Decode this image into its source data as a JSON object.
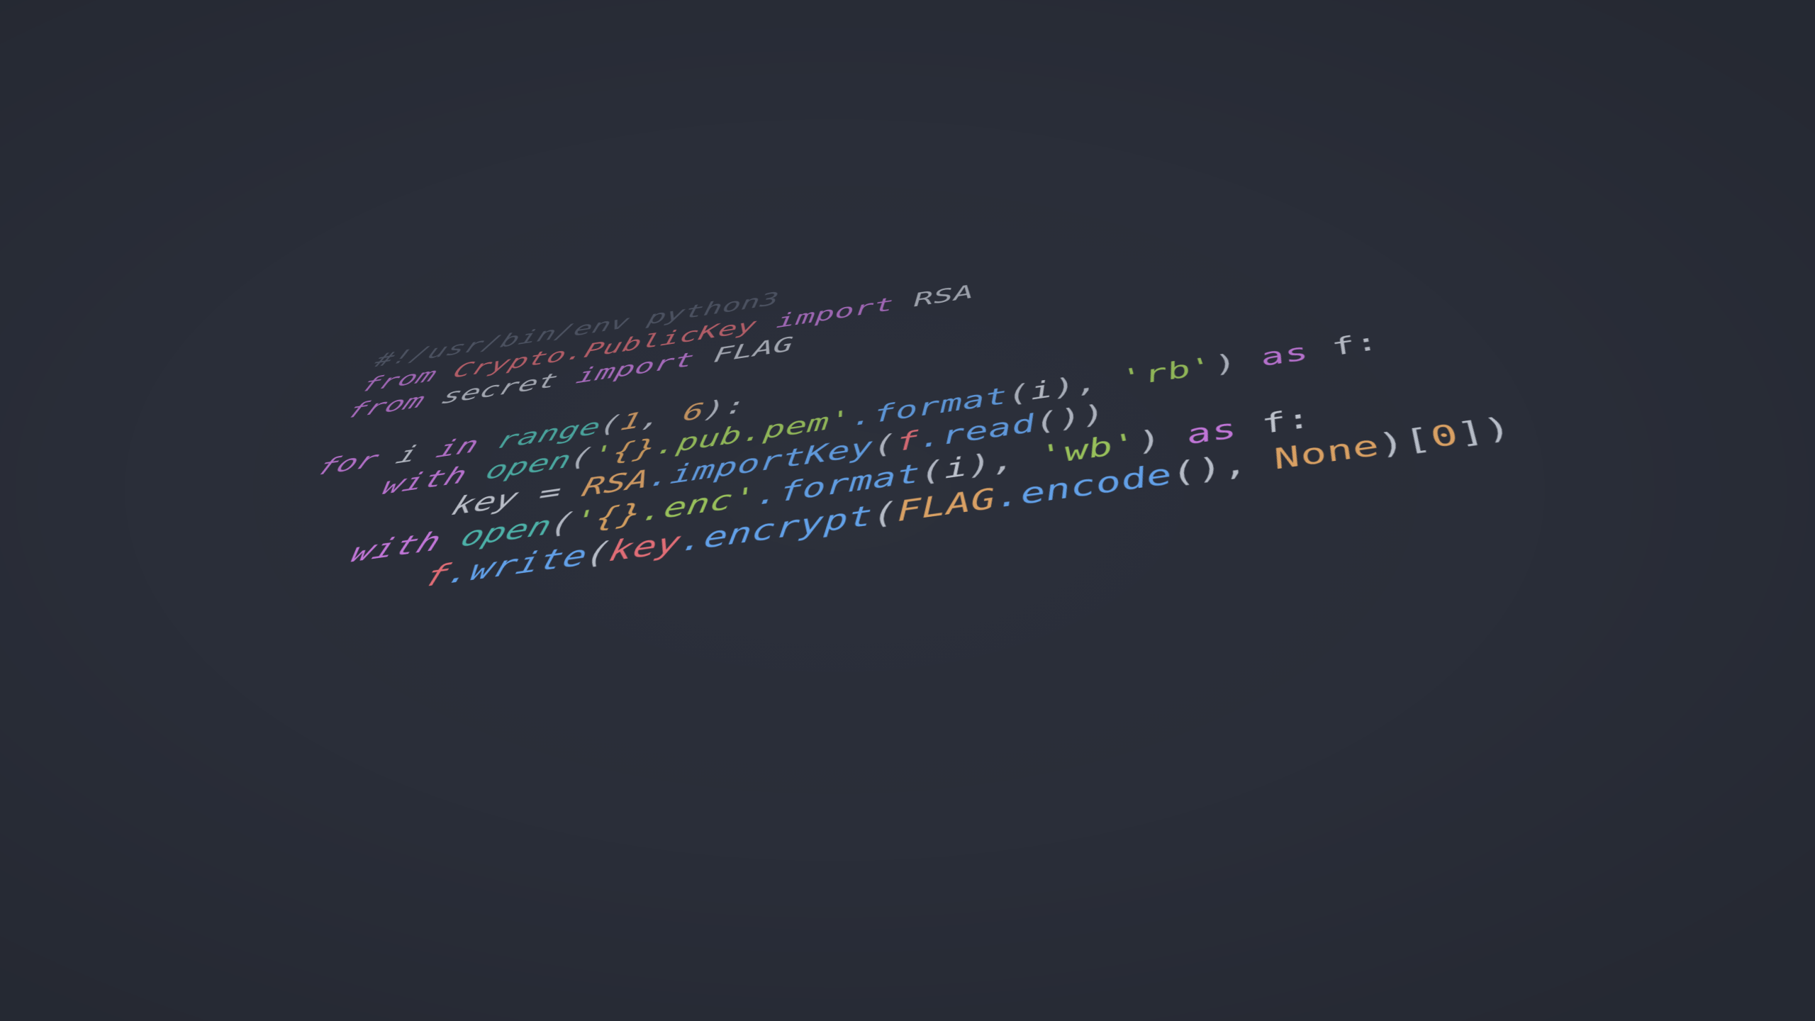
{
  "wallpaper": {
    "background_color": "#2a2e39",
    "language": "python",
    "title": "rsa-encrypt-flag-script"
  },
  "palette": {
    "background": "#2a2e39",
    "comment": "#596070",
    "keyword": "#c678dd",
    "module": "#e06c75",
    "builtin_function": "#4db6ac",
    "string": "#9cc65a",
    "format_placeholder": "#d7a05e",
    "method": "#61a0e8",
    "number": "#d9a063",
    "constant": "#d9a063",
    "variable": "#e06c75",
    "plain_text": "#c3c8d2"
  },
  "code": {
    "lines": [
      {
        "id": "line-shebang",
        "text": "#!/usr/bin/env python3",
        "tokens": [
          {
            "t": "#!/usr/bin/env python3",
            "c": "tok-comment"
          }
        ]
      },
      {
        "id": "line-import-rsa",
        "text": "from Crypto.PublicKey import RSA",
        "tokens": [
          {
            "t": "from",
            "c": "tok-keyword"
          },
          {
            "t": " ",
            "c": "tok-plain"
          },
          {
            "t": "Crypto.PublicKey",
            "c": "tok-module"
          },
          {
            "t": " ",
            "c": "tok-plain"
          },
          {
            "t": "import",
            "c": "tok-keyword"
          },
          {
            "t": " ",
            "c": "tok-plain"
          },
          {
            "t": "RSA",
            "c": "tok-caps"
          }
        ]
      },
      {
        "id": "line-import-flag",
        "text": "from secret import FLAG",
        "tokens": [
          {
            "t": "from",
            "c": "tok-keyword"
          },
          {
            "t": " ",
            "c": "tok-plain"
          },
          {
            "t": "secret",
            "c": "tok-plain"
          },
          {
            "t": " ",
            "c": "tok-plain"
          },
          {
            "t": "import",
            "c": "tok-keyword"
          },
          {
            "t": " ",
            "c": "tok-plain"
          },
          {
            "t": "FLAG",
            "c": "tok-caps"
          }
        ]
      },
      {
        "id": "line-blank-1",
        "text": "",
        "tokens": []
      },
      {
        "id": "line-for-loop",
        "text": "for i in range(1, 6):",
        "tokens": [
          {
            "t": "for",
            "c": "tok-keyword"
          },
          {
            "t": " ",
            "c": "tok-plain"
          },
          {
            "t": "i",
            "c": "tok-plain"
          },
          {
            "t": " ",
            "c": "tok-plain"
          },
          {
            "t": "in",
            "c": "tok-keyword"
          },
          {
            "t": " ",
            "c": "tok-plain"
          },
          {
            "t": "range",
            "c": "tok-builtin"
          },
          {
            "t": "(",
            "c": "tok-punct"
          },
          {
            "t": "1",
            "c": "tok-number"
          },
          {
            "t": ", ",
            "c": "tok-punct"
          },
          {
            "t": "6",
            "c": "tok-number"
          },
          {
            "t": "):",
            "c": "tok-punct"
          }
        ]
      },
      {
        "id": "line-open-pub-pem",
        "text": "    with open('{}.pub.pem'.format(i), 'rb') as f:",
        "tokens": [
          {
            "t": "    ",
            "c": "tok-plain"
          },
          {
            "t": "with",
            "c": "tok-keyword"
          },
          {
            "t": " ",
            "c": "tok-plain"
          },
          {
            "t": "open",
            "c": "tok-builtin"
          },
          {
            "t": "(",
            "c": "tok-punct"
          },
          {
            "t": "'",
            "c": "tok-string"
          },
          {
            "t": "{}",
            "c": "tok-fmt"
          },
          {
            "t": ".pub.pem'",
            "c": "tok-string"
          },
          {
            "t": ".format",
            "c": "tok-method"
          },
          {
            "t": "(",
            "c": "tok-punct"
          },
          {
            "t": "i",
            "c": "tok-plain"
          },
          {
            "t": "), ",
            "c": "tok-punct"
          },
          {
            "t": "'rb'",
            "c": "tok-string"
          },
          {
            "t": ") ",
            "c": "tok-punct"
          },
          {
            "t": "as",
            "c": "tok-keyword"
          },
          {
            "t": " ",
            "c": "tok-plain"
          },
          {
            "t": "f:",
            "c": "tok-plain"
          }
        ]
      },
      {
        "id": "line-import-key",
        "text": "        key = RSA.importKey(f.read())",
        "tokens": [
          {
            "t": "        ",
            "c": "tok-plain"
          },
          {
            "t": "key",
            "c": "tok-plain"
          },
          {
            "t": " = ",
            "c": "tok-plain"
          },
          {
            "t": "RSA",
            "c": "tok-class"
          },
          {
            "t": ".importKey",
            "c": "tok-method"
          },
          {
            "t": "(",
            "c": "tok-punct"
          },
          {
            "t": "f",
            "c": "tok-var"
          },
          {
            "t": ".read",
            "c": "tok-method"
          },
          {
            "t": "())",
            "c": "tok-punct"
          }
        ]
      },
      {
        "id": "line-open-enc",
        "text": "    with open('{}.enc'.format(i), 'wb') as f:",
        "tokens": [
          {
            "t": "    ",
            "c": "tok-plain"
          },
          {
            "t": "with",
            "c": "tok-keyword"
          },
          {
            "t": " ",
            "c": "tok-plain"
          },
          {
            "t": "open",
            "c": "tok-builtin"
          },
          {
            "t": "(",
            "c": "tok-punct"
          },
          {
            "t": "'",
            "c": "tok-string"
          },
          {
            "t": "{}",
            "c": "tok-fmt"
          },
          {
            "t": ".enc'",
            "c": "tok-string"
          },
          {
            "t": ".format",
            "c": "tok-method"
          },
          {
            "t": "(",
            "c": "tok-punct"
          },
          {
            "t": "i",
            "c": "tok-plain"
          },
          {
            "t": "), ",
            "c": "tok-punct"
          },
          {
            "t": "'wb'",
            "c": "tok-string"
          },
          {
            "t": ") ",
            "c": "tok-punct"
          },
          {
            "t": "as",
            "c": "tok-keyword"
          },
          {
            "t": " ",
            "c": "tok-plain"
          },
          {
            "t": "f:",
            "c": "tok-plain"
          }
        ]
      },
      {
        "id": "line-write-encrypt",
        "text": "        f.write(key.encrypt(FLAG.encode(), None)[0])",
        "tokens": [
          {
            "t": "        ",
            "c": "tok-plain"
          },
          {
            "t": "f",
            "c": "tok-var"
          },
          {
            "t": ".write",
            "c": "tok-method"
          },
          {
            "t": "(",
            "c": "tok-punct"
          },
          {
            "t": "key",
            "c": "tok-var"
          },
          {
            "t": ".encrypt",
            "c": "tok-method"
          },
          {
            "t": "(",
            "c": "tok-punct"
          },
          {
            "t": "FLAG",
            "c": "tok-class"
          },
          {
            "t": ".encode",
            "c": "tok-method"
          },
          {
            "t": "(), ",
            "c": "tok-punct"
          },
          {
            "t": "None",
            "c": "tok-const"
          },
          {
            "t": ")[",
            "c": "tok-punct"
          },
          {
            "t": "0",
            "c": "tok-number"
          },
          {
            "t": "])",
            "c": "tok-punct"
          }
        ]
      }
    ]
  }
}
